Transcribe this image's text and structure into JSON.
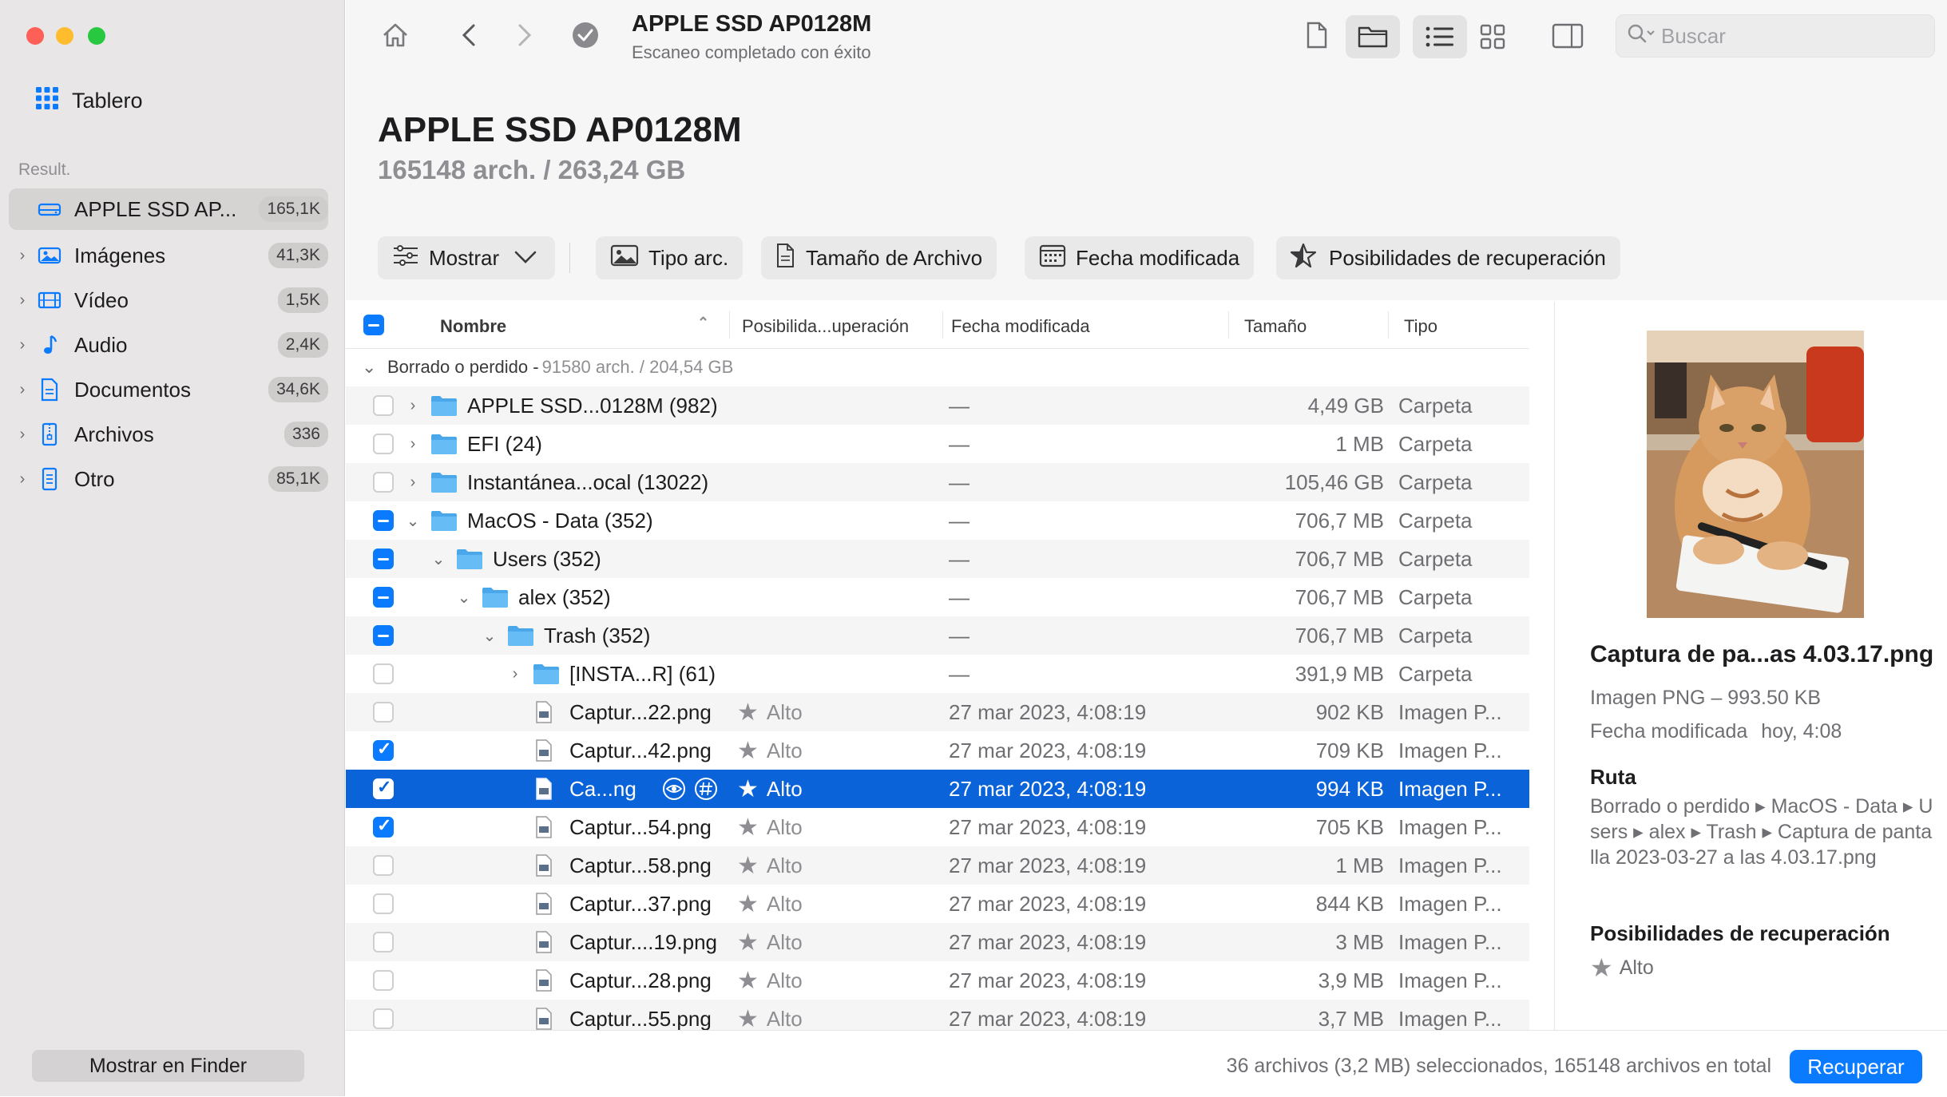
{
  "sidebar": {
    "dashboard": "Tablero",
    "section_label": "Result.",
    "items": [
      {
        "label": "APPLE SSD AP...",
        "count": "165,1K",
        "icon": "drive-icon",
        "selected": true
      },
      {
        "label": "Imágenes",
        "count": "41,3K",
        "icon": "image-icon"
      },
      {
        "label": "Vídeo",
        "count": "1,5K",
        "icon": "film-icon"
      },
      {
        "label": "Audio",
        "count": "2,4K",
        "icon": "music-note-icon"
      },
      {
        "label": "Documentos",
        "count": "34,6K",
        "icon": "document-icon"
      },
      {
        "label": "Archivos",
        "count": "336",
        "icon": "archive-icon"
      },
      {
        "label": "Otro",
        "count": "85,1K",
        "icon": "other-file-icon"
      }
    ],
    "finder_button": "Mostrar en Finder"
  },
  "toolbar": {
    "title": "APPLE SSD AP0128M",
    "subtitle": "Escaneo completado con éxito",
    "search_placeholder": "Buscar"
  },
  "header": {
    "title": "APPLE SSD AP0128M",
    "subtitle": "165148 arch. / 263,24 GB",
    "filters": {
      "show": "Mostrar",
      "file_type": "Tipo arc.",
      "file_size": "Tamaño de Archivo",
      "date_modified": "Fecha modificada",
      "recovery_chances": "Posibilidades de recuperación"
    }
  },
  "table": {
    "columns": {
      "name": "Nombre",
      "chances": "Posibilida...uperación",
      "date": "Fecha modificada",
      "size": "Tamaño",
      "type": "Tipo"
    },
    "group": {
      "label": "Borrado o perdido - ",
      "detail": "91580 arch. / 204,54 GB"
    },
    "rows": [
      {
        "name": "APPLE SSD...0128M (982)",
        "chances": "",
        "date": "—",
        "size": "4,49 GB",
        "type": "Carpeta"
      },
      {
        "name": "EFI (24)",
        "chances": "",
        "date": "—",
        "size": "1 MB",
        "type": "Carpeta"
      },
      {
        "name": "Instantánea...ocal (13022)",
        "chances": "",
        "date": "—",
        "size": "105,46 GB",
        "type": "Carpeta"
      },
      {
        "name": "MacOS - Data (352)",
        "chances": "",
        "date": "—",
        "size": "706,7 MB",
        "type": "Carpeta"
      },
      {
        "name": "Users (352)",
        "chances": "",
        "date": "—",
        "size": "706,7 MB",
        "type": "Carpeta"
      },
      {
        "name": "alex (352)",
        "chances": "",
        "date": "—",
        "size": "706,7 MB",
        "type": "Carpeta"
      },
      {
        "name": "Trash (352)",
        "chances": "",
        "date": "—",
        "size": "706,7 MB",
        "type": "Carpeta"
      },
      {
        "name": "[INSTA...R] (61)",
        "chances": "",
        "date": "—",
        "size": "391,9 MB",
        "type": "Carpeta"
      },
      {
        "name": "Captur...22.png",
        "chances": "Alto",
        "date": "27 mar 2023, 4:08:19",
        "size": "902 KB",
        "type": "Imagen P..."
      },
      {
        "name": "Captur...42.png",
        "chances": "Alto",
        "date": "27 mar 2023, 4:08:19",
        "size": "709 KB",
        "type": "Imagen P..."
      },
      {
        "name": "Ca...ng",
        "chances": "Alto",
        "date": "27 mar 2023, 4:08:19",
        "size": "994 KB",
        "type": "Imagen P..."
      },
      {
        "name": "Captur...54.png",
        "chances": "Alto",
        "date": "27 mar 2023, 4:08:19",
        "size": "705 KB",
        "type": "Imagen P..."
      },
      {
        "name": "Captur...58.png",
        "chances": "Alto",
        "date": "27 mar 2023, 4:08:19",
        "size": "1 MB",
        "type": "Imagen P..."
      },
      {
        "name": "Captur...37.png",
        "chances": "Alto",
        "date": "27 mar 2023, 4:08:19",
        "size": "844 KB",
        "type": "Imagen P..."
      },
      {
        "name": "Captur....19.png",
        "chances": "Alto",
        "date": "27 mar 2023, 4:08:19",
        "size": "3 MB",
        "type": "Imagen P..."
      },
      {
        "name": "Captur...28.png",
        "chances": "Alto",
        "date": "27 mar 2023, 4:08:19",
        "size": "3,9 MB",
        "type": "Imagen P..."
      },
      {
        "name": "Captur...55.png",
        "chances": "Alto",
        "date": "27 mar 2023, 4:08:19",
        "size": "3,7 MB",
        "type": "Imagen P..."
      }
    ]
  },
  "preview": {
    "filename": "Captura de pa...as 4.03.17.png",
    "kind": "Imagen PNG – 993.50 KB",
    "modified_label": "Fecha modificada",
    "modified_value": "hoy, 4:08",
    "path_label": "Ruta",
    "path": "Borrado o perdido ▸ MacOS - Data ▸ Users ▸ alex ▸ Trash ▸ Captura de pantalla 2023-03-27 a las 4.03.17.png",
    "chances_label": "Posibilidades de recuperación",
    "chances_value": "Alto"
  },
  "status": {
    "summary": "36 archivos (3,2 MB) seleccionados, 165148 archivos en total",
    "recover_button": "Recuperar"
  },
  "colors": {
    "accent": "#0a7aff",
    "selection": "#0a63d8",
    "sidebar_bg": "#e8e6e6"
  }
}
